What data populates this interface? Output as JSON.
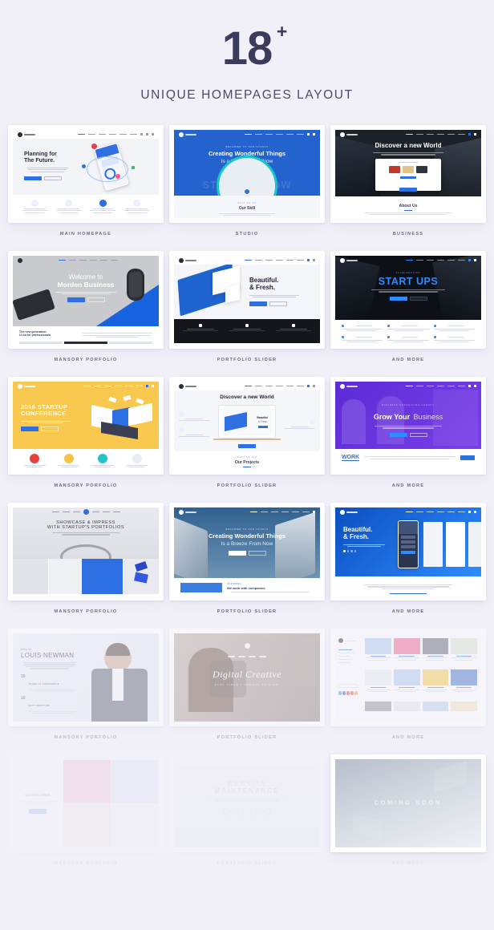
{
  "page": {
    "background": "#f1f0f9",
    "accent": "#2f6fe4",
    "ink": "#3b3c5c"
  },
  "header": {
    "count": "18",
    "plus": "+",
    "subtitle": "UNIQUE HOMEPAGES LAYOUT"
  },
  "cards": [
    {
      "caption": "MAIN HOMEPAGE",
      "headline": "Planning for",
      "headline2": "The Future.",
      "eyebrow": "",
      "section": "",
      "theme": "light"
    },
    {
      "caption": "STUDIO",
      "headline": "Creating Wonderful Things",
      "headline2": "Is a Breeze From Now",
      "eyebrow": "WELCOME TO OUR STUDIO",
      "section": "Our Skill",
      "section_kicker": "WHAT WE DO",
      "watermark": "START UP NOW",
      "theme": "blue"
    },
    {
      "caption": "BUSINESS",
      "headline": "Discover a new World",
      "headline2": "",
      "eyebrow": "",
      "section": "About Us",
      "section_kicker": "WHO WE ARE",
      "theme": "dark"
    },
    {
      "caption": "MANSORY PORFOLIO",
      "headline": "Welcome to",
      "headline2": "Morden Business",
      "eyebrow": "",
      "section": "The new generation",
      "section2": "UI kit for professionals",
      "theme": "gray"
    },
    {
      "caption": "PORTFOLIO SLIDER",
      "headline": "Beautiful.",
      "headline2": "& Fresh.",
      "eyebrow": "",
      "section": "",
      "theme": "light"
    },
    {
      "caption": "AND MORE",
      "headline": "START UPS",
      "headline2": "",
      "eyebrow": "ACCELERATING",
      "section": "",
      "theme": "dark"
    },
    {
      "caption": "MANSORY PORFOLIO",
      "headline": "2016 STARTUP",
      "headline2": "CONFERENCE",
      "eyebrow": "",
      "section": "",
      "theme": "yellow"
    },
    {
      "caption": "PORTFOLIO SLIDER",
      "headline": "Discover a new World",
      "headline2": "",
      "eyebrow": "",
      "section": "Our Projects",
      "section_kicker": "WHAT WE DID",
      "theme": "light"
    },
    {
      "caption": "AND MORE",
      "headline": "Grow Your",
      "headline2": "Business",
      "eyebrow": "BUSINESS CONSULTING AGENCY",
      "section": "WORK",
      "theme": "purple"
    },
    {
      "caption": "MANSORY PORFOLIO",
      "headline": "SHOWCASE & IMPRESS",
      "headline2": "WITH STARTUP'S PORTFOLIOS",
      "highlight": "STARTUP'S",
      "eyebrow": "",
      "section": "",
      "theme": "gray"
    },
    {
      "caption": "PORTFOLIO SLIDER",
      "headline": "Creating Wonderful Things",
      "headline2": "Is a Breeze From Now",
      "eyebrow": "WELCOME TO OUR STUDIO",
      "section": "We work with companies",
      "section_kicker": "OUR WORK",
      "theme": "steelblue"
    },
    {
      "caption": "AND MORE",
      "headline": "Beautiful.",
      "headline2": "& Fresh.",
      "eyebrow": "",
      "section": "",
      "theme": "bluegrad"
    },
    {
      "caption": "MANSORY PORFOLIO",
      "headline": "LOUIS NEWMAN",
      "eyebrow": "Hello I'm",
      "stat1_value": "15",
      "stat1_label": "YEARS OF EXPERIENCE",
      "stat2_value": "10",
      "stat2_label": "FACT ABOUT ME",
      "theme": "paleblue"
    },
    {
      "caption": "PORTFOLIO SLIDER",
      "headline": "Digital Creative",
      "eyebrow": "",
      "section": "PLAY VIDEO  |  SCROLL TO VIEW",
      "theme": "photo"
    },
    {
      "caption": "AND MORE",
      "headline": "",
      "section": "",
      "theme": "blog"
    },
    {
      "caption": "MANSORY PORFOLIO",
      "headline": "Our Best Work",
      "theme": "masonry"
    },
    {
      "caption": "PORTFOLIO SLIDER",
      "headline": "WEBSITE",
      "headline2": "MAINTENANCE",
      "theme": "maintenance"
    },
    {
      "caption": "AND MORE",
      "headline": "COMING SOON",
      "theme": "comingsoon"
    }
  ]
}
